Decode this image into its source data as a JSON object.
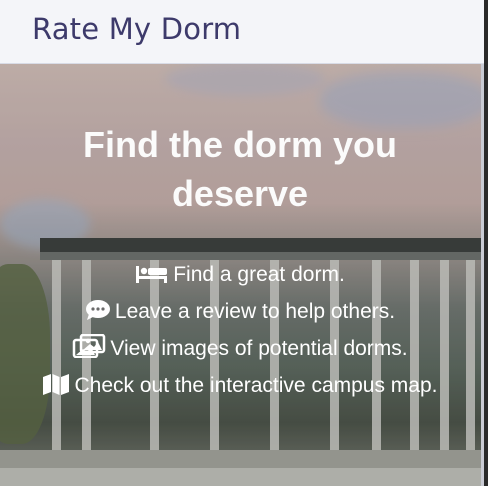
{
  "navbar": {
    "brand": "Rate My Dorm"
  },
  "hero": {
    "headline": "Find the dorm you deserve",
    "features": [
      {
        "icon": "bed-icon",
        "text": "Find a great dorm."
      },
      {
        "icon": "comment-icon",
        "text": "Leave a review to help others."
      },
      {
        "icon": "images-icon",
        "text": "View images of potential dorms."
      },
      {
        "icon": "map-icon",
        "text": "Check out the interactive campus map."
      }
    ]
  },
  "colors": {
    "brand_text": "#3d3a6b",
    "navbar_bg": "#f4f5f9",
    "hero_text": "#ffffff"
  }
}
